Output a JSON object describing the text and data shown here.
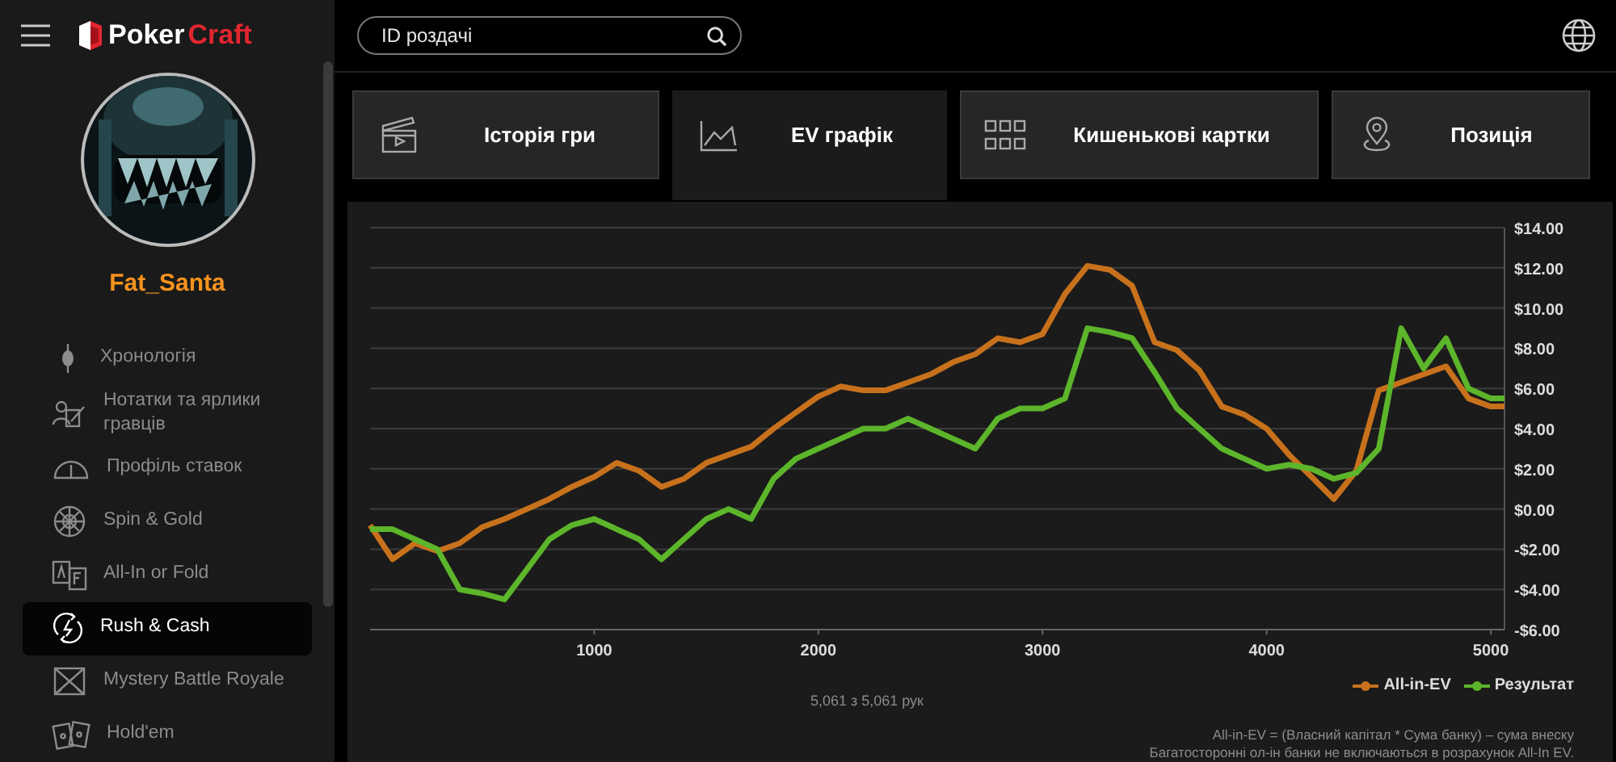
{
  "sidebar": {
    "logo": {
      "first": "Poker",
      "second": "Craft"
    },
    "username": "Fat_Santa",
    "items": [
      {
        "label": "Хронологія",
        "selected": false
      },
      {
        "label": "Нотатки та ярлики гравців",
        "selected": false
      },
      {
        "label": "Профіль ставок",
        "selected": false
      },
      {
        "label": "Spin & Gold",
        "selected": false
      },
      {
        "label": "All-In or Fold",
        "selected": false
      },
      {
        "label": "Rush & Cash",
        "selected": true
      },
      {
        "label": "Mystery Battle Royale",
        "selected": false
      },
      {
        "label": "Hold'em",
        "selected": false
      }
    ]
  },
  "search": {
    "placeholder": "ID роздачі"
  },
  "tabs": [
    {
      "label": "Історія гри",
      "selected": false
    },
    {
      "label": "EV графік",
      "selected": true
    },
    {
      "label": "Кишенькові картки",
      "selected": false
    },
    {
      "label": "Позиція",
      "selected": false
    }
  ],
  "chart": {
    "chart_data": {
      "type": "line",
      "grid": true,
      "x": [
        0,
        100,
        200,
        300,
        400,
        500,
        600,
        700,
        800,
        900,
        1000,
        1100,
        1200,
        1300,
        1400,
        1500,
        1600,
        1700,
        1800,
        1900,
        2000,
        2100,
        2200,
        2300,
        2400,
        2500,
        2600,
        2700,
        2800,
        2900,
        3000,
        3100,
        3200,
        3300,
        3400,
        3500,
        3600,
        3700,
        3800,
        3900,
        4000,
        4100,
        4200,
        4300,
        4400,
        4500,
        4600,
        4700,
        4800,
        4900,
        5000,
        5061
      ],
      "series": [
        {
          "name": "All-in-EV",
          "color": "#c8711c",
          "values": [
            -0.8,
            -2.5,
            -1.7,
            -2.1,
            -1.7,
            -0.9,
            -0.5,
            0.0,
            0.5,
            1.1,
            1.6,
            2.3,
            1.9,
            1.1,
            1.5,
            2.3,
            2.7,
            3.1,
            4.0,
            4.8,
            5.6,
            6.1,
            5.9,
            5.9,
            6.3,
            6.7,
            7.3,
            7.7,
            8.5,
            8.3,
            8.7,
            10.7,
            12.1,
            11.9,
            11.1,
            8.3,
            7.9,
            6.9,
            5.1,
            4.7,
            4.0,
            2.7,
            1.6,
            0.5,
            1.9,
            5.9,
            6.3,
            6.7,
            7.1,
            5.5,
            5.1,
            5.1
          ]
        },
        {
          "name": "Результат",
          "color": "#5cb52a",
          "values": [
            -1.0,
            -1.0,
            -1.5,
            -2.0,
            -4.0,
            -4.2,
            -4.5,
            -3.0,
            -1.5,
            -0.8,
            -0.5,
            -1.0,
            -1.5,
            -2.5,
            -1.5,
            -0.5,
            0.0,
            -0.5,
            1.5,
            2.5,
            3.0,
            3.5,
            4.0,
            4.0,
            4.5,
            4.0,
            3.5,
            3.0,
            4.5,
            5.0,
            5.0,
            5.5,
            9.0,
            8.8,
            8.5,
            6.8,
            5.0,
            4.0,
            3.0,
            2.5,
            2.0,
            2.2,
            2.0,
            1.5,
            1.8,
            3.0,
            9.0,
            7.0,
            8.5,
            6.0,
            5.5,
            5.5
          ]
        }
      ],
      "xlim": [
        0,
        5061
      ],
      "ylim": [
        -6,
        14
      ],
      "xticks": [
        1000,
        2000,
        3000,
        4000,
        5000
      ],
      "yticks": [
        {
          "value": 14,
          "label": "$14.00"
        },
        {
          "value": 12,
          "label": "$12.00"
        },
        {
          "value": 10,
          "label": "$10.00"
        },
        {
          "value": 8,
          "label": "$8.00"
        },
        {
          "value": 6,
          "label": "$6.00"
        },
        {
          "value": 4,
          "label": "$4.00"
        },
        {
          "value": 2,
          "label": "$2.00"
        },
        {
          "value": 0,
          "label": "$0.00"
        },
        {
          "value": -2,
          "label": "-$2.00"
        },
        {
          "value": -4,
          "label": "-$4.00"
        },
        {
          "value": -6,
          "label": "-$6.00"
        }
      ]
    },
    "count": "5,061 з 5,061 рук",
    "notes": [
      "All-in-EV = (Власний капітал * Сума банку) – сума внеску",
      "Багатосторонні ол-ін банки не включаються в розрахунок All-In EV."
    ]
  }
}
